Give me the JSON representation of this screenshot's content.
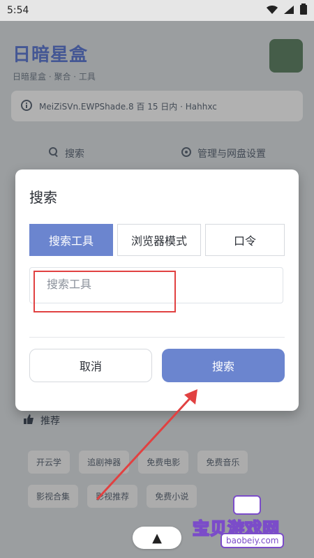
{
  "statusbar": {
    "time": "5:54",
    "icons": [
      "wifi-icon",
      "signal-icon",
      "battery-icon"
    ]
  },
  "background": {
    "title": "日暗星盒",
    "subtitle": "日暗星盒 · 聚合 · 工具",
    "announcement": "MeiZiSVn.EWPShade.8 百 15 日内 · Hahhxc",
    "row_items": [
      {
        "icon": "search-icon",
        "label": "搜索"
      },
      {
        "icon": "settings-icon",
        "label": "管理与网盘设置"
      }
    ],
    "recommend_title": "推荐",
    "recommend_chips": [
      "开云学",
      "追剧神器",
      "免费电影",
      "免费音乐",
      "影视合集",
      "影视推荐",
      "免费小说"
    ]
  },
  "dialog": {
    "title": "搜索",
    "tabs": [
      {
        "label": "搜索工具",
        "active": true
      },
      {
        "label": "浏览器模式",
        "active": false
      },
      {
        "label": "口令",
        "active": false
      }
    ],
    "search": {
      "placeholder": "搜索工具",
      "value": ""
    },
    "cancel_label": "取消",
    "search_label": "搜索"
  },
  "colors": {
    "accent": "#6b85cf",
    "highlight": "#e14141",
    "dimmed_overlay": "#00000040"
  },
  "bottom_pill": {
    "icon": "up-arrow-icon",
    "label": "▲"
  },
  "watermark": {
    "text": "宝贝游戏网",
    "domain": "baobeiy.com"
  }
}
